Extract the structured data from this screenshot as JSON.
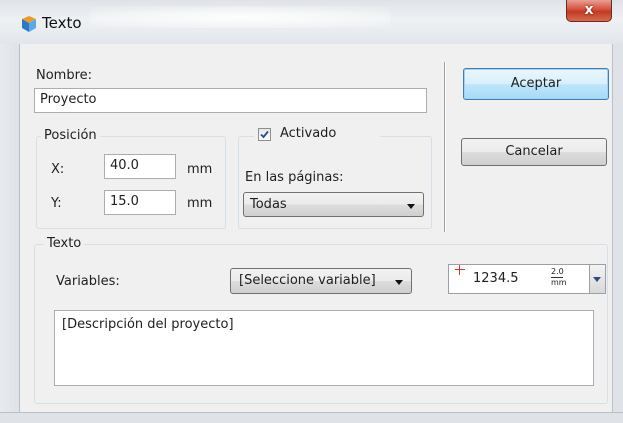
{
  "window": {
    "title": "Texto",
    "close_glyph": "x",
    "app_icon": "app-pencil-icon"
  },
  "nombre": {
    "label": "Nombre:",
    "value": "Proyecto"
  },
  "posicion": {
    "title": "Posición",
    "x_label": "X:",
    "x_value": "40.0",
    "x_unit": "mm",
    "y_label": "Y:",
    "y_value": "15.0",
    "y_unit": "mm"
  },
  "activado": {
    "label": "Activado",
    "checked": true,
    "paginas_label": "En las páginas:",
    "paginas_value": "Todas"
  },
  "buttons": {
    "aceptar": "Aceptar",
    "cancelar": "Cancelar"
  },
  "texto": {
    "title": "Texto",
    "variables_label": "Variables:",
    "variables_value": "[Seleccione variable]",
    "size_preview_value": "1234.5",
    "size_top": "2.0",
    "size_unit": "mm",
    "content": "[Descripción del proyecto]"
  },
  "colors": {
    "accent": "#3c7fb1",
    "close_red": "#c23a24"
  }
}
